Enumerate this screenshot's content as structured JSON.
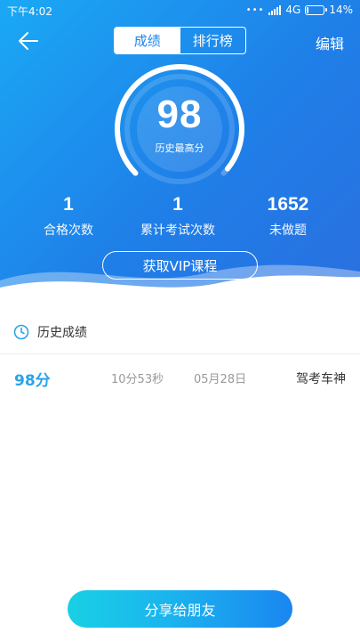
{
  "status_bar": {
    "time": "下午4:02",
    "network": "4G",
    "battery": "14%",
    "battery_level": 0.14
  },
  "nav": {
    "tabs": [
      {
        "label": "成绩",
        "active": true
      },
      {
        "label": "排行榜",
        "active": false
      }
    ],
    "edit_label": "编辑",
    "back_icon": "arrow-left-icon"
  },
  "score_card": {
    "best_score": "98",
    "best_score_label": "历史最高分",
    "gauge_level": 0.98
  },
  "stats": [
    {
      "value": "1",
      "label": "合格次数"
    },
    {
      "value": "1",
      "label": "累计考试次数"
    },
    {
      "value": "1652",
      "label": "未做题"
    }
  ],
  "vip_button_label": "获取VIP课程",
  "history": {
    "title": "历史成绩",
    "icon": "clock-icon",
    "records": [
      {
        "score": "98分",
        "duration": "10分53秒",
        "date": "05月28日",
        "title": "驾考车神"
      }
    ]
  },
  "share_button_label": "分享给朋友",
  "colors": {
    "primary_blue": "#1f86ec",
    "accent_cyan": "#19d0e4",
    "score_text": "#2aa3e9"
  }
}
